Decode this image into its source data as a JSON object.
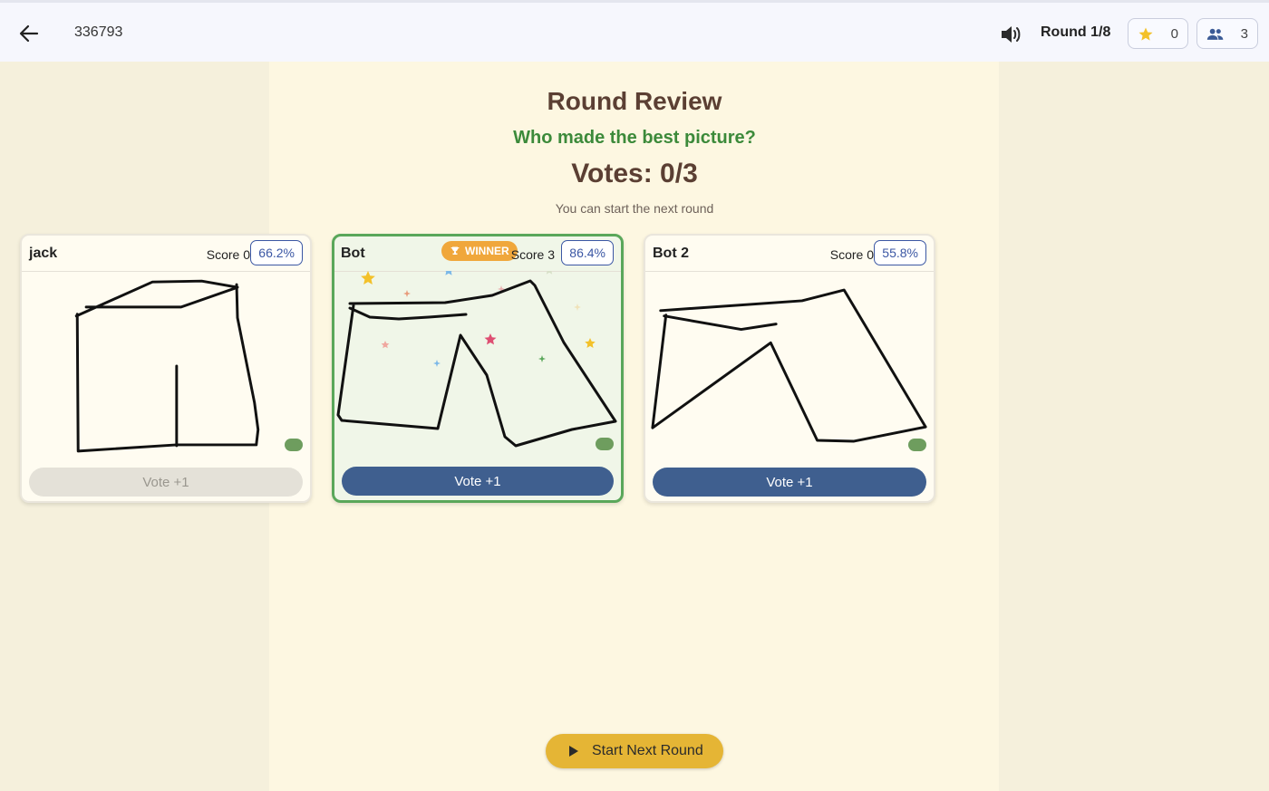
{
  "header": {
    "room_code": "336793",
    "round_label": "Round 1/8",
    "stars_count": "0",
    "players_count": "3"
  },
  "review": {
    "title": "Round Review",
    "subtitle": "Who made the best picture?",
    "votes_label": "Votes: 0/3",
    "hint": "You can start the next round"
  },
  "cards": [
    {
      "name": "jack",
      "score": "Score 0",
      "similarity": "66.2%",
      "vote_label": "Vote +1",
      "winner": false,
      "vote_enabled": false
    },
    {
      "name": "Bot",
      "score": "Score 3",
      "similarity": "86.4%",
      "vote_label": "Vote +1",
      "winner": true,
      "winner_label": "WINNER",
      "vote_enabled": true
    },
    {
      "name": "Bot 2",
      "score": "Score 0",
      "similarity": "55.8%",
      "vote_label": "Vote +1",
      "winner": false,
      "vote_enabled": true
    }
  ],
  "start_button": {
    "label": "Start Next Round"
  },
  "colors": {
    "accent": "#3f5f8f",
    "winner_border": "#5aa75a",
    "winner_badge": "#f0a73b",
    "start_button": "#e5b535"
  },
  "icons": [
    "back-arrow-icon",
    "speaker-icon",
    "star-icon",
    "people-icon",
    "trophy-icon",
    "play-icon"
  ]
}
